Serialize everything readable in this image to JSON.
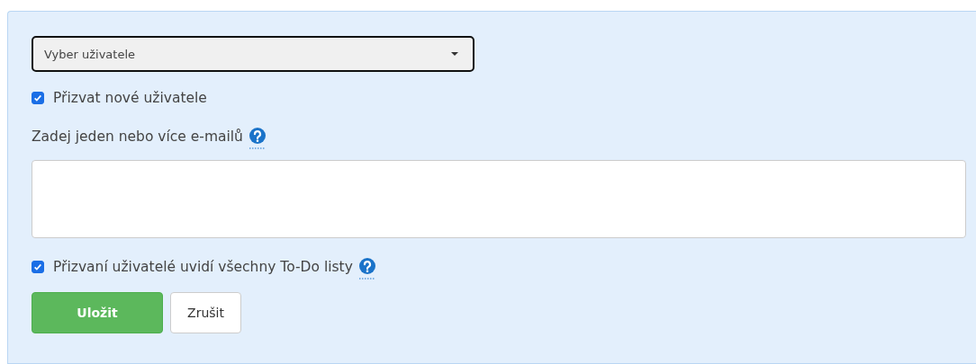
{
  "user_select": {
    "placeholder": "Vyber uživatele"
  },
  "invite_checkbox": {
    "label": "Přizvat nové uživatele",
    "checked": true
  },
  "emails": {
    "label": "Zadej jeden nebo více e-mailů",
    "help": true
  },
  "visibility_checkbox": {
    "label": "Přizvaní uživatelé uvidí všechny To-Do listy",
    "checked": true,
    "help": true
  },
  "buttons": [
    {
      "label": "Uložit",
      "kind": "primary"
    },
    {
      "label": "Zrušit",
      "kind": "secondary"
    }
  ]
}
